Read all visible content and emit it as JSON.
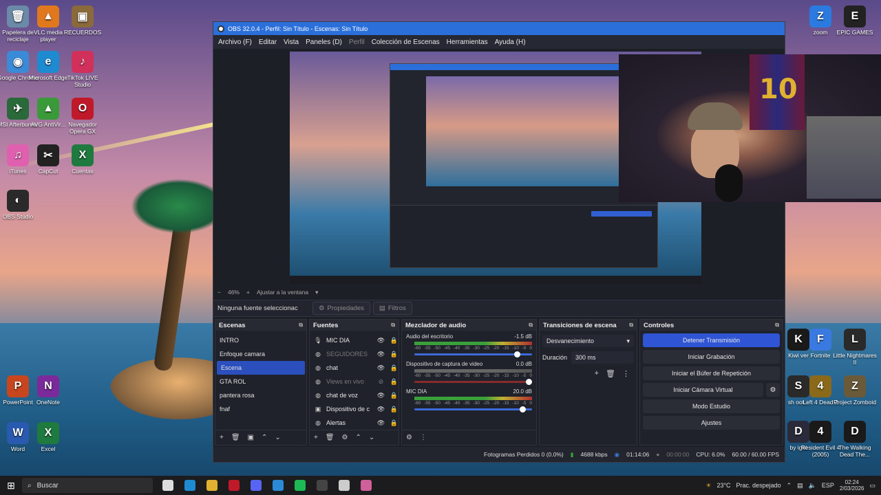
{
  "desktop": {
    "left_icons": [
      {
        "label": "Papelera de reciclaje",
        "color": "#6a8aa8",
        "glyph": "🗑"
      },
      {
        "label": "VLC media player",
        "color": "#e0781e",
        "glyph": "▲"
      },
      {
        "label": "RECUERDOS",
        "color": "#8a6a3a",
        "glyph": "▣"
      },
      {
        "label": "Google Chrome",
        "color": "#3a8ad8",
        "glyph": "◉"
      },
      {
        "label": "Microsoft Edge",
        "color": "#1e8ad0",
        "glyph": "e"
      },
      {
        "label": "TikTok LIVE Studio",
        "color": "#d0305a",
        "glyph": "♪"
      },
      {
        "label": "MSI Afterburner",
        "color": "#2a6a3a",
        "glyph": "✈"
      },
      {
        "label": "AVG AntiVir...",
        "color": "#3a9a3a",
        "glyph": "▲"
      },
      {
        "label": "Navegador Opera GX",
        "color": "#c01a2a",
        "glyph": "O"
      },
      {
        "label": "iTunes",
        "color": "#e060b0",
        "glyph": "♫"
      },
      {
        "label": "CapCut",
        "color": "#222222",
        "glyph": "✂"
      },
      {
        "label": "Cuentas",
        "color": "#1e7a3e",
        "glyph": "X"
      },
      {
        "label": "OBS Studio",
        "color": "#2a2a2a",
        "glyph": "◐"
      },
      {
        "label": "PowerPoint",
        "color": "#c8461e",
        "glyph": "P"
      },
      {
        "label": "OneNote",
        "color": "#7a2a9a",
        "glyph": "N"
      },
      {
        "label": "Word",
        "color": "#2a5ab0",
        "glyph": "W"
      },
      {
        "label": "Excel",
        "color": "#1e7a3e",
        "glyph": "X"
      }
    ],
    "right_icons": [
      {
        "label": "zoom",
        "color": "#2a7ae0",
        "glyph": "Z"
      },
      {
        "label": "EPIC GAMES",
        "color": "#222222",
        "glyph": "E"
      },
      {
        "label": "Kiwi ver",
        "color": "#1a1a1a",
        "glyph": "K"
      },
      {
        "label": "Fortnite",
        "color": "#3a7ae0",
        "glyph": "F"
      },
      {
        "label": "Little Nightmares II",
        "color": "#2a2a2a",
        "glyph": "L"
      },
      {
        "label": "sh oot...",
        "color": "#2a2a2a",
        "glyph": "S"
      },
      {
        "label": "Left 4 Dead 2",
        "color": "#8a6a1a",
        "glyph": "4"
      },
      {
        "label": "Project Zomboid",
        "color": "#6a5a3a",
        "glyph": "Z"
      },
      {
        "label": "by ight",
        "color": "#2a2a3a",
        "glyph": "D"
      },
      {
        "label": "Resident Evil 4 (2005)",
        "color": "#1a1a1a",
        "glyph": "4"
      },
      {
        "label": "The Walking Dead The...",
        "color": "#1a1a1a",
        "glyph": "D"
      }
    ]
  },
  "obs": {
    "title": "OBS 32.0.4 - Perfil: Sin Título - Escenas: Sin Título",
    "menu": [
      "Archivo (F)",
      "Editar",
      "Vista",
      "Paneles (D)",
      "Perfil",
      "Colección de Escenas",
      "Herramientas",
      "Ayuda (H)"
    ],
    "zoom": "46%",
    "zoom_mode": "Ajustar a la ventana",
    "webcam_jersey": "10",
    "no_source": "Ninguna fuente seleccionac",
    "properties": "Propiedades",
    "filters": "Filtros",
    "scenes": {
      "title": "Escenas",
      "items": [
        "INTRO",
        "Enfoque camara",
        "Escena",
        "GTA ROL",
        "pantera rosa",
        "fnaf"
      ],
      "selected": 2
    },
    "sources": {
      "title": "Fuentes",
      "items": [
        {
          "name": "MIC DIA",
          "icon": "mic",
          "visible": true
        },
        {
          "name": "SEGUIDORES",
          "icon": "browser",
          "visible": true,
          "dim": true
        },
        {
          "name": "chat",
          "icon": "browser",
          "visible": true
        },
        {
          "name": "Views en vivo",
          "icon": "browser",
          "visible": false,
          "dim": true
        },
        {
          "name": "chat de voz",
          "icon": "browser",
          "visible": true
        },
        {
          "name": "Dispositivo de c",
          "icon": "camera",
          "visible": true
        },
        {
          "name": "Alertas",
          "icon": "browser",
          "visible": true
        }
      ]
    },
    "mixer": {
      "title": "Mezclador de audio",
      "scale": [
        "-60",
        "-55",
        "-50",
        "-45",
        "-40",
        "-35",
        "-30",
        "-25",
        "-20",
        "-15",
        "-10",
        "-5",
        "0"
      ],
      "channels": [
        {
          "name": "Audio del escritorio",
          "db": "-1.5 dB",
          "level": 0.85,
          "fader": 0.9
        },
        {
          "name": "Dispositivo de captura de video",
          "db": "0.0 dB",
          "level": 0.0,
          "fader": 1.0,
          "muted": true
        },
        {
          "name": "MIC DIA",
          "db": "20.0 dB",
          "level": 0.75,
          "fader": 0.95
        }
      ]
    },
    "transitions": {
      "title": "Transiciones de escena",
      "selected": "Desvanecimiento",
      "duration_label": "Duración",
      "duration": "300 ms"
    },
    "controls": {
      "title": "Controles",
      "buttons": [
        "Detener Transmisión",
        "Iniciar Grabación",
        "Iniciar el Búfer de Repetición",
        "Iniciar Cámara Virtual",
        "Modo Estudio",
        "Ajustes"
      ]
    },
    "status": {
      "dropped": "Fotogramas Perdidos 0 (0.0%)",
      "bitrate": "4688 kbps",
      "live_time": "01:14:06",
      "rec_time": "00:00:00",
      "cpu": "CPU: 6.0%",
      "fps": "60.00 / 60.00 FPS"
    }
  },
  "taskbar": {
    "search": "Buscar",
    "weather": "23°C",
    "weather_desc": "Prac. despejado",
    "lang": "ESP",
    "time": "02:24",
    "date": "2/03/2026",
    "apps": [
      {
        "name": "task-view",
        "color": "#dddddd"
      },
      {
        "name": "edge",
        "color": "#1e8ad0"
      },
      {
        "name": "explorer",
        "color": "#e0b030"
      },
      {
        "name": "opera-gx",
        "color": "#c01a2a"
      },
      {
        "name": "discord",
        "color": "#5865f2"
      },
      {
        "name": "store",
        "color": "#2a8ad8"
      },
      {
        "name": "spotify",
        "color": "#1db954"
      },
      {
        "name": "obs",
        "color": "#444444"
      },
      {
        "name": "settings",
        "color": "#cccccc"
      },
      {
        "name": "copilot",
        "color": "#d0609a"
      }
    ]
  }
}
